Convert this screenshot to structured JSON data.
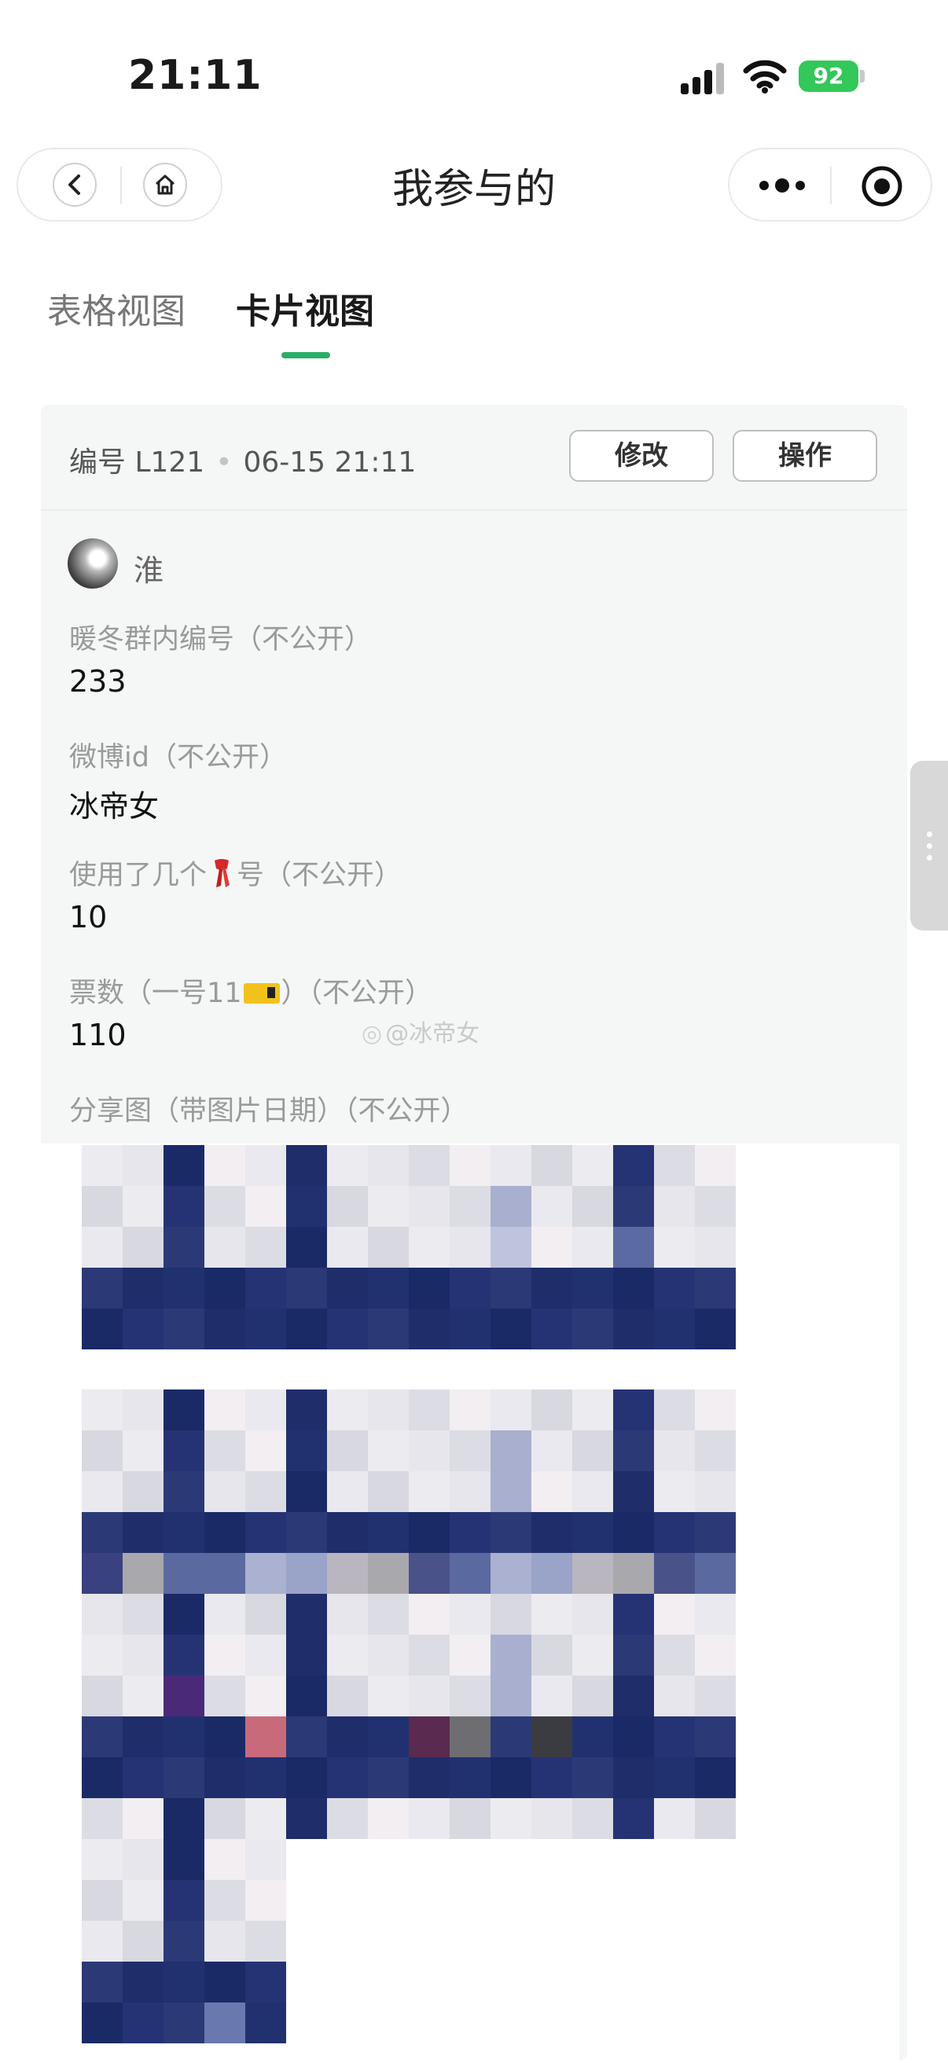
{
  "status_bar": {
    "time": "21:11",
    "battery": "92"
  },
  "nav": {
    "title": "我参与的"
  },
  "tabs": [
    {
      "label": "表格视图",
      "active": false
    },
    {
      "label": "卡片视图",
      "active": true
    }
  ],
  "card": {
    "id_label": "编号 L121",
    "datetime": "06-15 21:11",
    "edit_button": "修改",
    "action_button": "操作",
    "user_name": "淮",
    "fields": [
      {
        "label": "暖冬群内编号（不公开）",
        "value": "233"
      },
      {
        "label": "微博id（不公开）",
        "value": "冰帝女"
      },
      {
        "label_prefix": "使用了几个",
        "label_suffix": "号（不公开）",
        "value": "10"
      },
      {
        "label_prefix": "票数（一号11",
        "label_suffix": "）（不公开）",
        "value": "110"
      }
    ],
    "share_label": "分享图（带图片日期）（不公开）",
    "watermark": "@冰帝女"
  },
  "colors": {
    "accent": "#2aae67",
    "battery": "#34c759",
    "navy": "#1e2a6e"
  }
}
